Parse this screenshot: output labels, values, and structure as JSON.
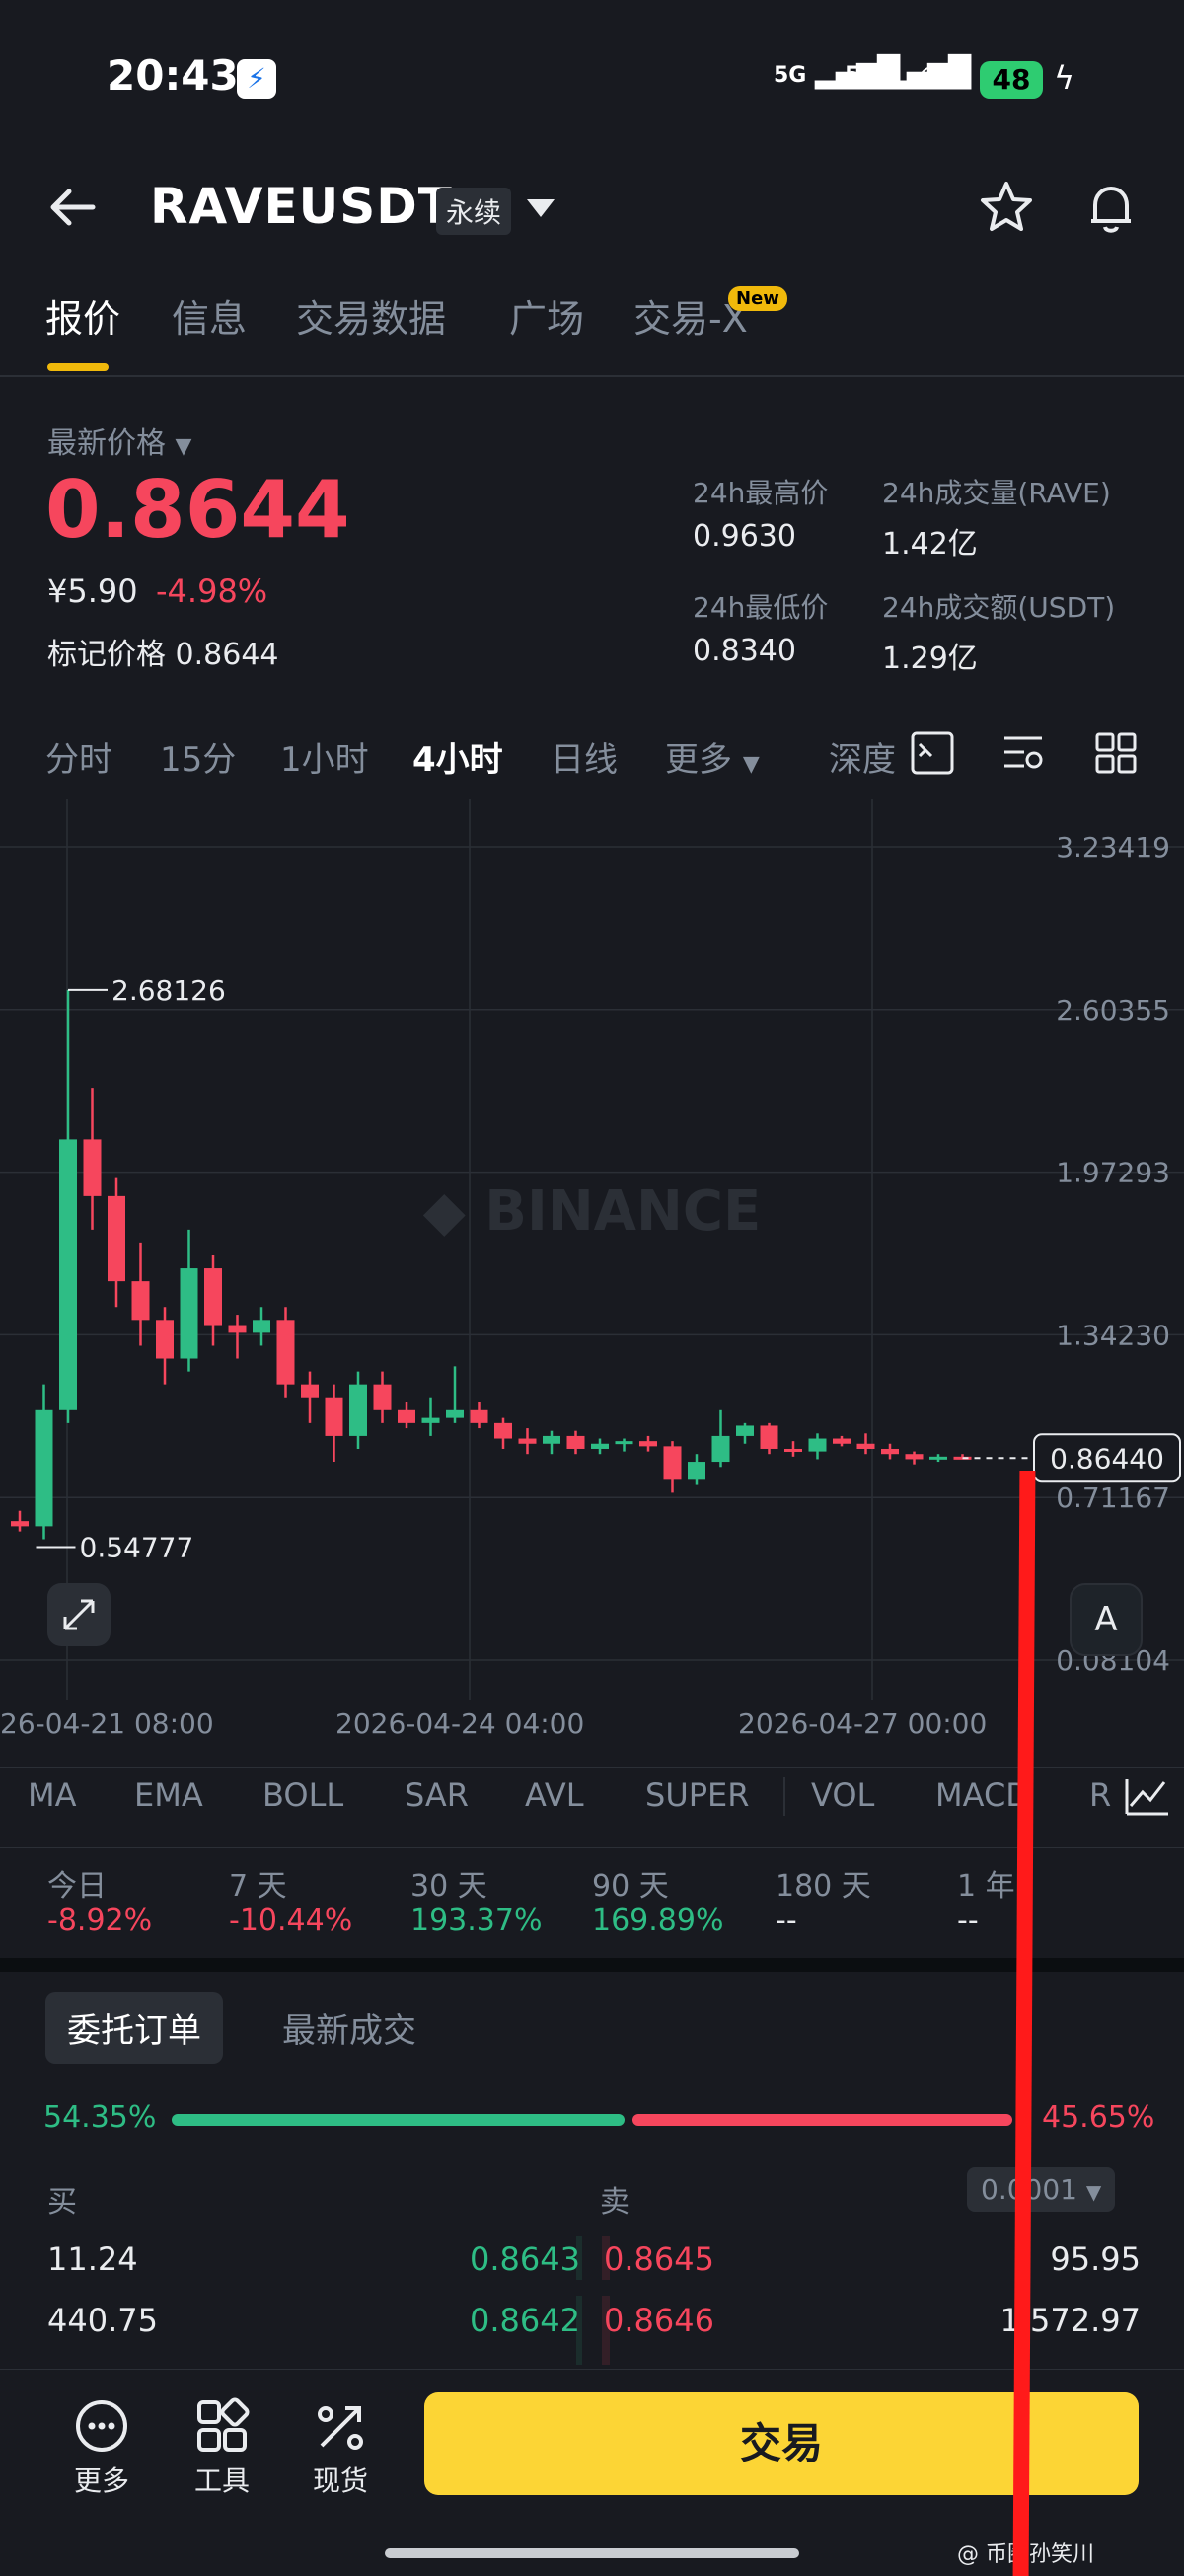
{
  "status_bar": {
    "time": "20:43",
    "signal1": "5G",
    "signal2": "5G",
    "battery": "48"
  },
  "header": {
    "title": "RAVEUSDT",
    "contract_tag": "永续"
  },
  "tabs": [
    {
      "label": "报价"
    },
    {
      "label": "信息"
    },
    {
      "label": "交易数据"
    },
    {
      "label": "广场"
    },
    {
      "label": "交易-X"
    }
  ],
  "new_badge": "New",
  "price": {
    "label": "最新价格",
    "last": "0.8644",
    "cny": "¥5.90",
    "change": "-4.98%",
    "mark_label": "标记价格",
    "mark_value": "0.8644"
  },
  "stats": {
    "high_label": "24h最高价",
    "high": "0.9630",
    "vol_label": "24h成交量(RAVE)",
    "vol": "1.42亿",
    "low_label": "24h最低价",
    "low": "0.8340",
    "amt_label": "24h成交额(USDT)",
    "amt": "1.29亿"
  },
  "intervals": [
    "分时",
    "15分",
    "1小时",
    "4小时",
    "日线",
    "更多",
    "深度"
  ],
  "active_interval": "4小时",
  "chart_data": {
    "type": "candlestick",
    "y_ticks": [
      "3.23419",
      "2.60355",
      "1.97293",
      "1.34230",
      "0.71167",
      "0.08104"
    ],
    "x_ticks": [
      "26-04-21 08:00",
      "2026-04-24 04:00",
      "2026-04-27 00:00"
    ],
    "high_label": "2.68126",
    "low_label": "0.54777",
    "current_price_label": "0.86440",
    "watermark": "BINANCE",
    "ylim": [
      0.08104,
      3.23419
    ],
    "candles": [
      {
        "o": 0.62,
        "h": 0.66,
        "l": 0.58,
        "c": 0.6
      },
      {
        "o": 0.6,
        "h": 1.15,
        "l": 0.55,
        "c": 1.05
      },
      {
        "o": 1.05,
        "h": 2.68,
        "l": 1.0,
        "c": 2.1
      },
      {
        "o": 2.1,
        "h": 2.3,
        "l": 1.75,
        "c": 1.88
      },
      {
        "o": 1.88,
        "h": 1.95,
        "l": 1.45,
        "c": 1.55
      },
      {
        "o": 1.55,
        "h": 1.7,
        "l": 1.3,
        "c": 1.4
      },
      {
        "o": 1.4,
        "h": 1.45,
        "l": 1.15,
        "c": 1.25
      },
      {
        "o": 1.25,
        "h": 1.75,
        "l": 1.2,
        "c": 1.6
      },
      {
        "o": 1.6,
        "h": 1.65,
        "l": 1.3,
        "c": 1.38
      },
      {
        "o": 1.38,
        "h": 1.42,
        "l": 1.25,
        "c": 1.35
      },
      {
        "o": 1.35,
        "h": 1.45,
        "l": 1.3,
        "c": 1.4
      },
      {
        "o": 1.4,
        "h": 1.45,
        "l": 1.1,
        "c": 1.15
      },
      {
        "o": 1.15,
        "h": 1.2,
        "l": 1.0,
        "c": 1.1
      },
      {
        "o": 1.1,
        "h": 1.15,
        "l": 0.85,
        "c": 0.95
      },
      {
        "o": 0.95,
        "h": 1.2,
        "l": 0.9,
        "c": 1.15
      },
      {
        "o": 1.15,
        "h": 1.2,
        "l": 1.0,
        "c": 1.05
      },
      {
        "o": 1.05,
        "h": 1.08,
        "l": 0.98,
        "c": 1.0
      },
      {
        "o": 1.0,
        "h": 1.1,
        "l": 0.95,
        "c": 1.02
      },
      {
        "o": 1.02,
        "h": 1.22,
        "l": 1.0,
        "c": 1.05
      },
      {
        "o": 1.05,
        "h": 1.08,
        "l": 0.98,
        "c": 1.0
      },
      {
        "o": 1.0,
        "h": 1.02,
        "l": 0.9,
        "c": 0.94
      },
      {
        "o": 0.94,
        "h": 0.98,
        "l": 0.88,
        "c": 0.92
      },
      {
        "o": 0.92,
        "h": 0.97,
        "l": 0.88,
        "c": 0.95
      },
      {
        "o": 0.95,
        "h": 0.97,
        "l": 0.88,
        "c": 0.9
      },
      {
        "o": 0.9,
        "h": 0.94,
        "l": 0.88,
        "c": 0.92
      },
      {
        "o": 0.92,
        "h": 0.94,
        "l": 0.89,
        "c": 0.93
      },
      {
        "o": 0.93,
        "h": 0.95,
        "l": 0.89,
        "c": 0.91
      },
      {
        "o": 0.91,
        "h": 0.93,
        "l": 0.73,
        "c": 0.78
      },
      {
        "o": 0.78,
        "h": 0.88,
        "l": 0.76,
        "c": 0.85
      },
      {
        "o": 0.85,
        "h": 1.05,
        "l": 0.83,
        "c": 0.95
      },
      {
        "o": 0.95,
        "h": 1.0,
        "l": 0.92,
        "c": 0.99
      },
      {
        "o": 0.99,
        "h": 1.0,
        "l": 0.88,
        "c": 0.9
      },
      {
        "o": 0.9,
        "h": 0.93,
        "l": 0.87,
        "c": 0.89
      },
      {
        "o": 0.89,
        "h": 0.96,
        "l": 0.86,
        "c": 0.94
      },
      {
        "o": 0.94,
        "h": 0.95,
        "l": 0.91,
        "c": 0.92
      },
      {
        "o": 0.92,
        "h": 0.96,
        "l": 0.88,
        "c": 0.9
      },
      {
        "o": 0.9,
        "h": 0.92,
        "l": 0.86,
        "c": 0.88
      },
      {
        "o": 0.88,
        "h": 0.89,
        "l": 0.84,
        "c": 0.86
      },
      {
        "o": 0.86,
        "h": 0.88,
        "l": 0.85,
        "c": 0.87
      },
      {
        "o": 0.87,
        "h": 0.88,
        "l": 0.86,
        "c": 0.865
      }
    ]
  },
  "indicators": [
    "MA",
    "EMA",
    "BOLL",
    "SAR",
    "AVL",
    "SUPER",
    "VOL",
    "MACD",
    "R"
  ],
  "performance": [
    {
      "label": "今日",
      "value": "-8.92%",
      "dir": "down"
    },
    {
      "label": "7 天",
      "value": "-10.44%",
      "dir": "down"
    },
    {
      "label": "30 天",
      "value": "193.37%",
      "dir": "up"
    },
    {
      "label": "90 天",
      "value": "169.89%",
      "dir": "up"
    },
    {
      "label": "180 天",
      "value": "--",
      "dir": "none"
    },
    {
      "label": "1 年",
      "value": "--",
      "dir": "none"
    }
  ],
  "book_tabs": {
    "active": "委托订单",
    "other": "最新成交"
  },
  "ratio": {
    "buy": "54.35%",
    "sell": "45.65%",
    "buy_fraction": 0.5435
  },
  "book_headers": {
    "buy": "买",
    "sell": "卖",
    "precision": "0.0001"
  },
  "order_book": [
    {
      "bid_qty": "11.24",
      "bid": "0.8643",
      "ask": "0.8645",
      "ask_qty": "95.95"
    },
    {
      "bid_qty": "440.75",
      "bid": "0.8642",
      "ask": "0.8646",
      "ask_qty": "1,572.97"
    }
  ],
  "bottom_nav": [
    {
      "label": "更多"
    },
    {
      "label": "工具"
    },
    {
      "label": "现货"
    }
  ],
  "trade_button": "交易",
  "watermark": "@ 币圈孙笑川",
  "colors": {
    "up": "#2ebd85",
    "down": "#f6465d",
    "accent": "#f0b90b",
    "trade": "#fcd535"
  }
}
